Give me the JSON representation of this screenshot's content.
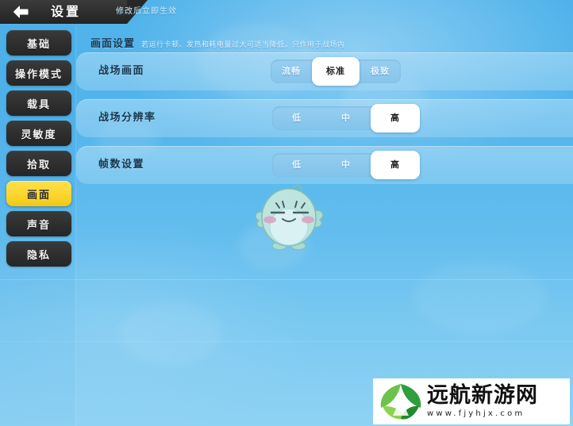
{
  "header": {
    "back_icon": "arrow-left-icon",
    "title": "设置",
    "subtitle": "修改后立即生效"
  },
  "sidebar": {
    "items": [
      {
        "label": "基础",
        "active": false
      },
      {
        "label": "操作模式",
        "active": false
      },
      {
        "label": "载具",
        "active": false
      },
      {
        "label": "灵敏度",
        "active": false
      },
      {
        "label": "拾取",
        "active": false
      },
      {
        "label": "画面",
        "active": true
      },
      {
        "label": "声音",
        "active": false
      },
      {
        "label": "隐私",
        "active": false
      }
    ]
  },
  "section": {
    "title": "画面设置",
    "description": "若运行卡顿、发热和耗电量过大可适当降低，只作用于战场内"
  },
  "settings": {
    "rows": [
      {
        "label": "战场画面",
        "options": [
          {
            "label": "流畅",
            "selected": false
          },
          {
            "label": "标准",
            "selected": true
          },
          {
            "label": "极致",
            "selected": false
          }
        ]
      },
      {
        "label": "战场分辨率",
        "options": [
          {
            "label": "低",
            "selected": false
          },
          {
            "label": "中",
            "selected": false
          },
          {
            "label": "高",
            "selected": true
          }
        ]
      },
      {
        "label": "帧数设置",
        "options": [
          {
            "label": "低",
            "selected": false
          },
          {
            "label": "中",
            "selected": false
          },
          {
            "label": "高",
            "selected": true
          }
        ]
      }
    ]
  },
  "mascot": {
    "name": "bird-mascot",
    "body_color": "#b9e4de",
    "belly_color": "#d8f0f4"
  },
  "watermark": {
    "site_name": "远航新游网",
    "url": "www.fjyhjx.com",
    "logo_icon": "green-leaf-logo",
    "accent_color": "#3faf2e"
  },
  "colors": {
    "background_top": "#4fb2ea",
    "background_bottom": "#8fd2f3",
    "active_tab": "#fcd62f",
    "panel": "#bee4f8",
    "selected_pill": "#ffffff"
  }
}
